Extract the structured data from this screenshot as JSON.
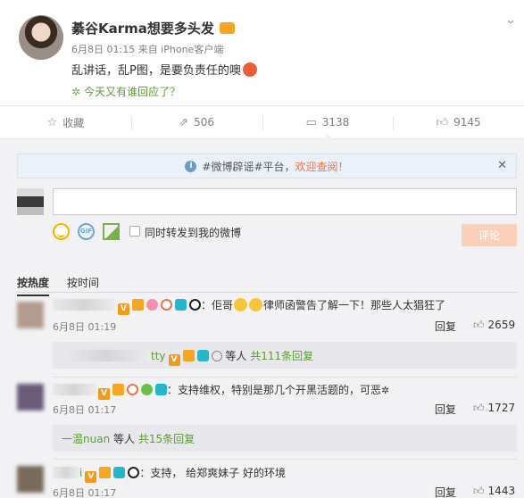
{
  "post": {
    "username": "綦谷Karma想要多头发",
    "meta": "6月8日 01:15 来自 iPhone客户端",
    "text": "乱讲话，乱P图，是要负责任的噢",
    "topic": "今天又有谁回应了？"
  },
  "actions": [
    {
      "label": "收藏",
      "icon": "star-icon"
    },
    {
      "label": "506",
      "icon": "share-icon"
    },
    {
      "label": "3138",
      "icon": "comment-icon"
    },
    {
      "label": "9145",
      "icon": "like-icon"
    }
  ],
  "notice": {
    "prefix": "#微博辟谣#平台，",
    "link": "欢迎查阅！"
  },
  "composer": {
    "repost_label": "同时转发到我的微博",
    "submit_label": "评论"
  },
  "sort": {
    "hot": "按热度",
    "time": "按时间"
  },
  "comments": [
    {
      "text_a": "：佢哥",
      "text_b": "律师函警告了解一下！那些人太猖狂了",
      "date": "6月8日 01:19",
      "reply": "回复",
      "likes": "2659",
      "sub": {
        "name_tail": "tty",
        "mid": "等人",
        "count_text": "共111条回复"
      }
    },
    {
      "text": "：支持维权，特别是那几个开黑活题的，可恶",
      "date": "6月8日 01:17",
      "reply": "回复",
      "likes": "1727",
      "sub": {
        "name": "一温nuan",
        "mid": "等人",
        "count_text": "共15条回复"
      }
    },
    {
      "name_tail": "i",
      "text": "：支持， 给郑爽妹子 好的环境",
      "date": "6月8日 01:17",
      "reply": "回复",
      "likes": "1443"
    }
  ],
  "colors": {
    "accent": "#eb7350",
    "topic_green": "#5a9e2f",
    "bg_comments": "#f2f2f5",
    "notice_bg": "#eaf1f8"
  }
}
